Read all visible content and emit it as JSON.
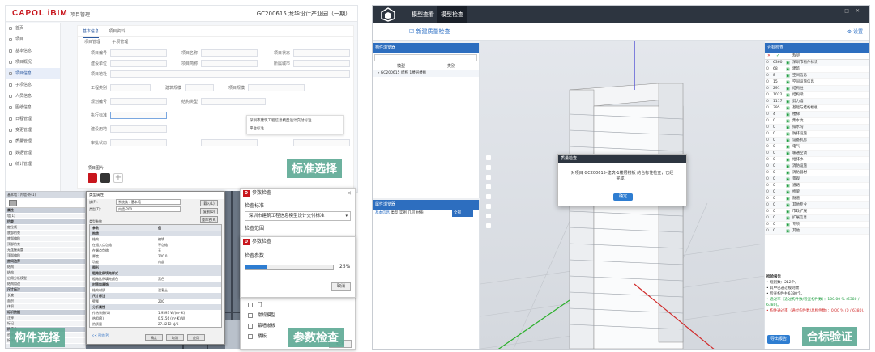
{
  "web": {
    "logo": "CAPOL iBIM",
    "nav_title": "项目管理",
    "project": "GC200615  龙华设计产业园（一期）",
    "sidebar": [
      "首页",
      "项目",
      "基本信息",
      "项目概况",
      "项目信息",
      "子项信息",
      "人员信息",
      "图纸信息",
      "日程管理",
      "变更管理",
      "质量管理",
      "数据管理",
      "统计管理"
    ],
    "tabs": [
      "基本信息",
      "项目资料"
    ],
    "subtabs": [
      "项目管理",
      "子项管理"
    ],
    "fields": [
      "项目编号",
      "项目名称",
      "项目状态",
      "建设单位",
      "项目简称",
      "所属城市",
      "项目地址",
      "工程类别",
      "建筑规模",
      "项目规模",
      "执行标准",
      "规划编号",
      "结构类型",
      "建设用地",
      "审批状态"
    ],
    "dropdown": [
      "深圳市建筑工程信息模型设计交付标准",
      "平台标准"
    ],
    "attach_label": "项目图片"
  },
  "labels": {
    "standard": "标准选择",
    "component": "构件选择",
    "param": "参数检查",
    "compliance": "合标验证"
  },
  "cad": {
    "title": "基本墙 : 内墙-外(1)",
    "rows": [
      "属性",
      "墙(1)",
      "约束",
      "定位线",
      "底部约束",
      "底部偏移",
      "顶部约束",
      "无连接高度",
      "顶部偏移",
      "房间边界",
      "结构",
      "结构",
      "启用分析模型",
      "结构用途",
      "尺寸标注",
      "长度",
      "面积",
      "体积",
      "标识数据",
      "注释",
      "标记",
      "阶段化",
      "创建的阶段",
      "拆除的阶段"
    ]
  },
  "dlg1": {
    "title": "类型属性",
    "family_label": "族(F):",
    "family": "系统族 : 基本墙",
    "type_label": "类型(T):",
    "type": "内墙-200",
    "load_btn": "载入(L)",
    "dup_btn": "复制(D)",
    "rename_btn": "重命名(R)",
    "section": "类型参数",
    "col1": "参数",
    "col2": "值",
    "rows": [
      [
        "构造",
        ""
      ],
      [
        "结构",
        "编辑..."
      ],
      [
        "在插入点包络",
        "不包络"
      ],
      [
        "在端点包络",
        "无"
      ],
      [
        "厚度",
        "200.0"
      ],
      [
        "功能",
        "内部"
      ],
      [
        "图形",
        ""
      ],
      [
        "粗略比例填充样式",
        ""
      ],
      [
        "粗略比例填充颜色",
        "黑色"
      ],
      [
        "材质和装饰",
        ""
      ],
      [
        "结构材质",
        "混凝土"
      ],
      [
        "尺寸标注",
        ""
      ],
      [
        "壁厚",
        "200"
      ],
      [
        "分析属性",
        ""
      ],
      [
        "传热系数(U)",
        "1.9393 W/(m²·K)"
      ],
      [
        "热阻(R)",
        "0.5156 (m²·K)/W"
      ],
      [
        "热质量",
        "27.4212 kJ/K"
      ],
      [
        "吸收率",
        "0.700000"
      ],
      [
        "粗糙度",
        "3"
      ],
      [
        "标识数据",
        ""
      ],
      [
        "类型图像",
        ""
      ],
      [
        "注释记号",
        "C1010"
      ]
    ],
    "preview_link": "<< 预览(P)",
    "ok": "确定",
    "cancel": "取消",
    "apply": "应用"
  },
  "pc1": {
    "title": "参数检查",
    "label": "检查标准",
    "value": "深圳市建筑工程信息模型设计交付标准",
    "range": "检查范围",
    "items": [
      "门",
      "常规模型",
      "幕墙嵌板",
      "楼板"
    ],
    "cancel": "取消"
  },
  "pc2": {
    "title": "参数检查",
    "label": "检查参数",
    "progress": 25,
    "pct": "25%",
    "cancel": "取消"
  },
  "bim": {
    "tabs": [
      "模型查看",
      "模型检查"
    ],
    "new_check": "新建质量检查",
    "settings": "设置",
    "left_panel": "构件浏览器",
    "left_cols": [
      "模型",
      "类别"
    ],
    "tree_item": "GC200615 结构 1楼层楼板",
    "left_panel2": "属性浏览器",
    "prop_tabs": [
      "基本信息",
      "类型",
      "实例",
      "几何",
      "材质"
    ],
    "prop_select": "全部",
    "right_panel": "合标检查",
    "right_head": "规则",
    "rules": [
      {
        "n": "0",
        "c": "6360",
        "t": "深圳市构件标识"
      },
      {
        "n": "0",
        "c": "68",
        "t": "建筑"
      },
      {
        "n": "0",
        "c": "8",
        "t": "空间信息"
      },
      {
        "n": "0",
        "c": "15",
        "t": "空间设施信息"
      },
      {
        "n": "0",
        "c": "291",
        "t": "结构柱"
      },
      {
        "n": "0",
        "c": "1022",
        "t": "结构梁"
      },
      {
        "n": "0",
        "c": "1117",
        "t": "剪力墙"
      },
      {
        "n": "0",
        "c": "395",
        "t": "基础与结构楼板"
      },
      {
        "n": "0",
        "c": "4",
        "t": "楼梯"
      },
      {
        "n": "0",
        "c": "0",
        "t": "集水坑"
      },
      {
        "n": "0",
        "c": "0",
        "t": "排水沟"
      },
      {
        "n": "0",
        "c": "0",
        "t": "防排设施"
      },
      {
        "n": "0",
        "c": "0",
        "t": "设备机房"
      },
      {
        "n": "0",
        "c": "0",
        "t": "电气"
      },
      {
        "n": "0",
        "c": "0",
        "t": "暖通空调"
      },
      {
        "n": "0",
        "c": "0",
        "t": "给排水"
      },
      {
        "n": "0",
        "c": "0",
        "t": "消防设施"
      },
      {
        "n": "0",
        "c": "0",
        "t": "消防器材"
      },
      {
        "n": "0",
        "c": "0",
        "t": "景观"
      },
      {
        "n": "0",
        "c": "0",
        "t": "道路"
      },
      {
        "n": "0",
        "c": "0",
        "t": "桥梁"
      },
      {
        "n": "0",
        "c": "0",
        "t": "隧道"
      },
      {
        "n": "0",
        "c": "0",
        "t": "其他专业"
      },
      {
        "n": "0",
        "c": "0",
        "t": "市政扩展"
      },
      {
        "n": "0",
        "c": "0",
        "t": "扩展信息"
      },
      {
        "n": "0",
        "c": "0",
        "t": "专项"
      },
      {
        "n": "0",
        "c": "0",
        "t": "其他"
      }
    ],
    "summary_title": "检验报告",
    "summary": [
      "• 规则数：212个。",
      "• 其中已通过规则数：",
      "• 检查构件共6380个。",
      "• 通过率（通过构件数/检查构件数）：100.00 % (6380 / 6380)。",
      "• 构件通过率（通过构件数/总构件数）：0.00 % (0 / 6380)。"
    ],
    "export": "导出报告",
    "modal_title": "质量检查",
    "modal_text": "对项目 GC200615-建筑-1楼层楼板 的合标性检查，已经完成！",
    "modal_ok": "确定"
  },
  "colors": {
    "accent": "#2c6fc4",
    "brand": "#c8161d",
    "label_bg": "#60aa96",
    "pass": "#1a9b3c"
  }
}
